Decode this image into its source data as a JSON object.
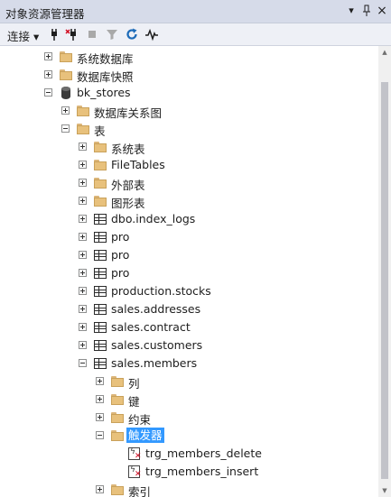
{
  "window": {
    "title": "对象资源管理器",
    "pin_symbol": "▾",
    "pushpin_symbol": "ᛁ",
    "close_symbol": "×"
  },
  "toolbar": {
    "connect_label": "连接 ▾"
  },
  "tree": [
    {
      "label": "系统数据库",
      "icon": "folder-icon",
      "expander": "plus",
      "depth": 0
    },
    {
      "label": "数据库快照",
      "icon": "folder-icon",
      "expander": "plus",
      "depth": 0
    },
    {
      "label": "bk_stores",
      "icon": "database-icon",
      "expander": "minus",
      "depth": 0
    },
    {
      "label": "数据库关系图",
      "icon": "folder-icon",
      "expander": "plus",
      "depth": 1
    },
    {
      "label": "表",
      "icon": "folder-icon",
      "expander": "minus",
      "depth": 1
    },
    {
      "label": "系统表",
      "icon": "folder-icon",
      "expander": "plus",
      "depth": 2
    },
    {
      "label": "FileTables",
      "icon": "folder-icon",
      "expander": "plus",
      "depth": 2
    },
    {
      "label": "外部表",
      "icon": "folder-icon",
      "expander": "plus",
      "depth": 2
    },
    {
      "label": "图形表",
      "icon": "folder-icon",
      "expander": "plus",
      "depth": 2
    },
    {
      "label": "dbo.index_logs",
      "icon": "table-icon",
      "expander": "plus",
      "depth": 2
    },
    {
      "label": "pro",
      "icon": "table-icon",
      "expander": "plus",
      "depth": 2
    },
    {
      "label": "pro",
      "icon": "table-icon",
      "expander": "plus",
      "depth": 2
    },
    {
      "label": "pro",
      "icon": "table-icon",
      "expander": "plus",
      "depth": 2
    },
    {
      "label": "production.stocks",
      "icon": "table-icon",
      "expander": "plus",
      "depth": 2
    },
    {
      "label": "sales.addresses",
      "icon": "table-icon",
      "expander": "plus",
      "depth": 2
    },
    {
      "label": "sales.contract",
      "icon": "table-icon",
      "expander": "plus",
      "depth": 2
    },
    {
      "label": "sales.customers",
      "icon": "table-icon",
      "expander": "plus",
      "depth": 2
    },
    {
      "label": "sales.members",
      "icon": "table-icon",
      "expander": "minus",
      "depth": 2
    },
    {
      "label": "列",
      "icon": "folder-icon",
      "expander": "plus",
      "depth": 3
    },
    {
      "label": "键",
      "icon": "folder-icon",
      "expander": "plus",
      "depth": 3
    },
    {
      "label": "约束",
      "icon": "folder-icon",
      "expander": "plus",
      "depth": 3
    },
    {
      "label": "触发器",
      "icon": "folder-icon",
      "expander": "minus",
      "depth": 3,
      "selected": true
    },
    {
      "label": "trg_members_delete",
      "icon": "trigger-icon",
      "expander": "none",
      "depth": 4
    },
    {
      "label": "trg_members_insert",
      "icon": "trigger-icon",
      "expander": "none",
      "depth": 4
    },
    {
      "label": "索引",
      "icon": "folder-icon",
      "expander": "plus",
      "depth": 3
    }
  ]
}
